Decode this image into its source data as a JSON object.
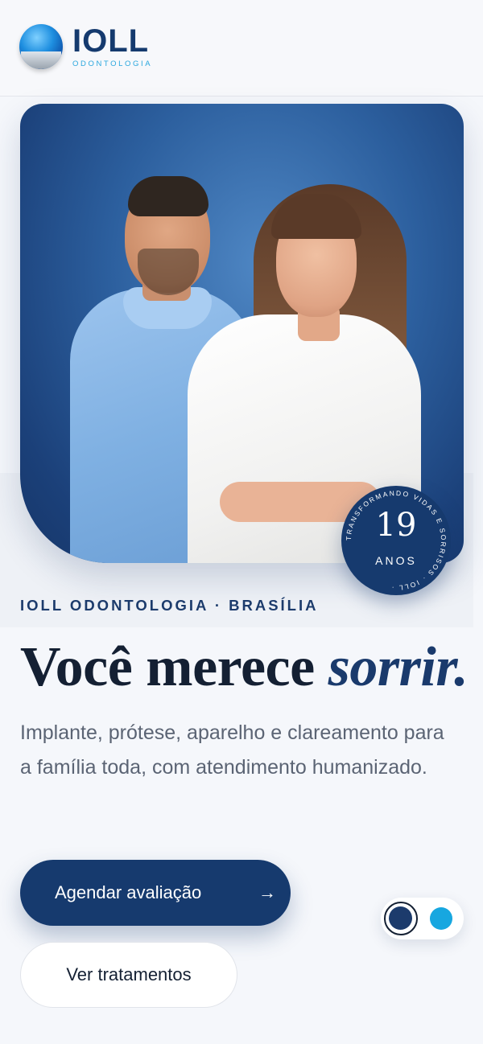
{
  "brand": {
    "name": "IOLL",
    "tagline": "ODONTOLOGIA"
  },
  "hero": {
    "image_alt": "Dentistas sorrindo",
    "badge": {
      "ring_text": "TRANSFORMANDO VIDAS E SORRISOS · IOLL ·",
      "number": "19",
      "unit": "ANOS"
    }
  },
  "intro": {
    "eyebrow": "IOLL ODONTOLOGIA · BRASÍLIA",
    "headline_main": "Você merece ",
    "headline_accent": "sorrir.",
    "description": "Implante, prótese, aparelho e clareamento para a família toda, com atendimento humanizado."
  },
  "actions": {
    "primary_label": "Agendar avaliação",
    "primary_icon": "→",
    "secondary_label": "Ver tratamentos"
  },
  "theme_toggle": {
    "options": [
      "navy",
      "sky"
    ],
    "selected": "navy",
    "colors": {
      "navy": "#1c3b6c",
      "sky": "#17a7e0"
    }
  },
  "colors": {
    "brand_navy": "#163a6e",
    "brand_sky": "#2aa7de",
    "text_dark": "#142033",
    "text_muted": "#5b6474"
  }
}
